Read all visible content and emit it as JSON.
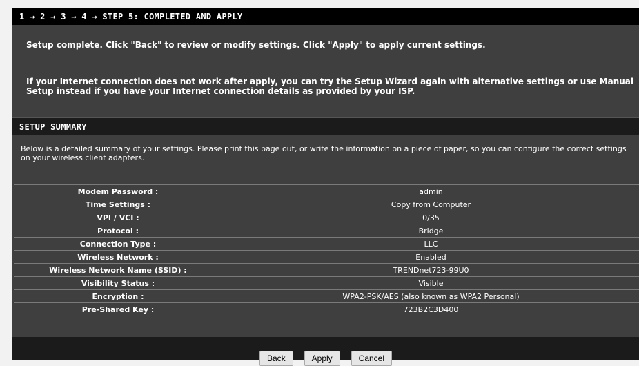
{
  "step_header": "1 → 2 → 3 → 4 → STEP 5: COMPLETED AND APPLY",
  "complete_text": "Setup complete. Click \"Back\" to review or modify settings. Click \"Apply\" to apply current settings.",
  "retry_text": "If your Internet connection does not work after apply, you can try the Setup Wizard again with alternative settings or use Manual Setup instead if you have your Internet connection details as provided by your ISP.",
  "summary_header": "SETUP SUMMARY",
  "summary_description": "Below is a detailed summary of your settings. Please print this page out, or write the information on a piece of paper, so you can configure the correct settings on your wireless client adapters.",
  "rows": [
    {
      "label": "Modem Password :",
      "value": "admin"
    },
    {
      "label": "Time Settings :",
      "value": "Copy from Computer"
    },
    {
      "label": "VPI / VCI :",
      "value": "0/35"
    },
    {
      "label": "Protocol :",
      "value": "Bridge"
    },
    {
      "label": "Connection Type :",
      "value": "LLC"
    },
    {
      "label": "Wireless Network :",
      "value": "Enabled"
    },
    {
      "label": "Wireless Network Name (SSID) :",
      "value": "TRENDnet723-99U0"
    },
    {
      "label": "Visibility Status :",
      "value": "Visible"
    },
    {
      "label": "Encryption :",
      "value": "WPA2-PSK/AES (also known as WPA2 Personal)"
    },
    {
      "label": "Pre-Shared Key :",
      "value": "723B2C3D400"
    }
  ],
  "buttons": {
    "back": "Back",
    "apply": "Apply",
    "cancel": "Cancel"
  }
}
